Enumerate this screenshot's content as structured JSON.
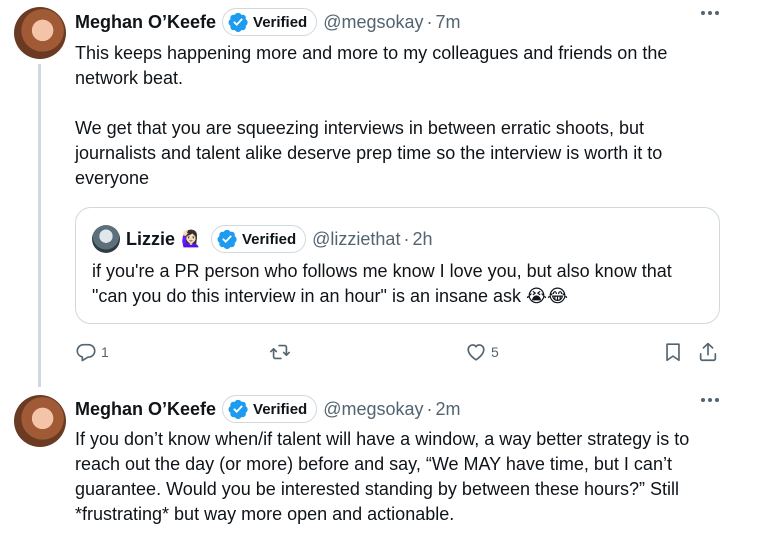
{
  "tweet1": {
    "author_name": "Meghan O’Keefe",
    "verified_label": "Verified",
    "handle": "@megsokay",
    "separator": "·",
    "time": "7m",
    "paragraph1": "This keeps happening more and more to my colleagues and friends on the network beat.",
    "paragraph2": "We get that you are squeezing interviews in between erratic shoots, but journalists and talent alike deserve prep time so the interview is worth it to everyone",
    "quote": {
      "author_name": "Lizzie",
      "emoji": "🙋🏻‍♀️",
      "verified_label": "Verified",
      "handle": "@lizziethat",
      "separator": "·",
      "time": "2h",
      "text": "if you're a PR person who follows me know I love you, but also know that \"can you do this interview in an hour\" is an insane ask 😭😂"
    },
    "actions": {
      "reply_count": "1",
      "retweet_count": "",
      "like_count": "5"
    }
  },
  "tweet2": {
    "author_name": "Meghan O’Keefe",
    "verified_label": "Verified",
    "handle": "@megsokay",
    "separator": "·",
    "time": "2m",
    "text": "If you don’t know when/if talent will have a window, a way better strategy is to reach out the day (or more) before and say, “We MAY have time, but I can’t guarantee. Would you be interested standing by between these hours?” Still *frustrating* but way more open and actionable."
  },
  "colors": {
    "verified_blue": "#1d9bf0",
    "secondary_text": "#536471",
    "border": "#cfd9de"
  }
}
